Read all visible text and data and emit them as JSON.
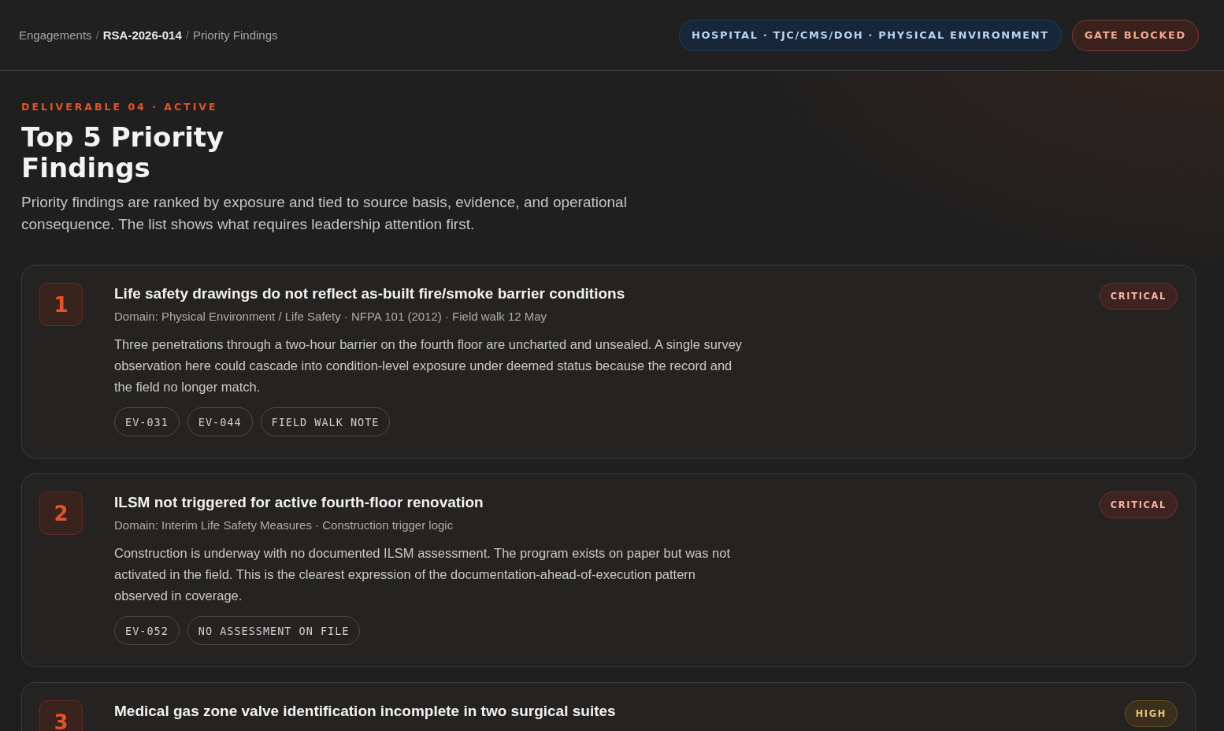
{
  "breadcrumb_separator": "/",
  "breadcrumb": [
    {
      "label": "Engagements",
      "current": false
    },
    {
      "label": "RSA-2026-014",
      "current": true
    },
    {
      "label": "Priority Findings",
      "current": false
    }
  ],
  "header_badges": [
    {
      "label": "HOSPITAL · TJC/CMS/DOH · PHYSICAL ENVIRONMENT",
      "kind": "info"
    },
    {
      "label": "GATE BLOCKED",
      "kind": "alert"
    }
  ],
  "eyebrow": "DELIVERABLE 04 · ACTIVE",
  "title": "Top 5 Priority Findings",
  "description": "Priority findings are ranked by exposure and tied to source basis, evidence, and operational consequence. The list shows what requires leadership attention first.",
  "findings": [
    {
      "rank": "1",
      "title": "Life safety drawings do not reflect as-built fire/smoke barrier conditions",
      "meta": "Domain: Physical Environment / Life Safety · NFPA 101 (2012) · Field walk 12 May",
      "body": "Three penetrations through a two-hour barrier on the fourth floor are uncharted and unsealed. A single survey observation here could cascade into condition-level exposure under deemed status because the record and the field no longer match.",
      "tags": [
        "EV-031",
        "EV-044",
        "FIELD WALK NOTE"
      ],
      "severity": {
        "label": "CRITICAL",
        "kind": "critical"
      }
    },
    {
      "rank": "2",
      "title": "ILSM not triggered for active fourth-floor renovation",
      "meta": "Domain: Interim Life Safety Measures · Construction trigger logic",
      "body": "Construction is underway with no documented ILSM assessment. The program exists on paper but was not activated in the field. This is the clearest expression of the documentation-ahead-of-execution pattern observed in coverage.",
      "tags": [
        "EV-052",
        "NO ASSESSMENT ON FILE"
      ],
      "severity": {
        "label": "CRITICAL",
        "kind": "critical"
      }
    },
    {
      "rank": "3",
      "title": "Medical gas zone valve identification incomplete in two surgical suites",
      "severity": {
        "label": "HIGH",
        "kind": "high"
      }
    }
  ]
}
